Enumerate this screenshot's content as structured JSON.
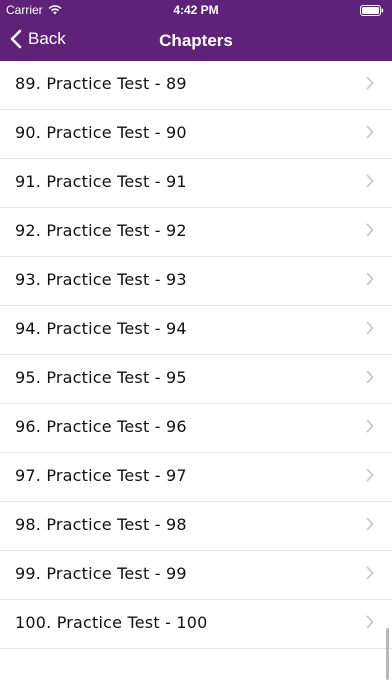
{
  "status_bar": {
    "carrier": "Carrier",
    "time": "4:42 PM",
    "wifi_icon": "wifi-icon",
    "battery_icon": "battery-icon"
  },
  "nav": {
    "back_label": "Back",
    "title": "Chapters",
    "back_icon": "chevron-left-icon"
  },
  "colors": {
    "nav_background": "#5e2378",
    "separator": "#e6e6e6",
    "chevron": "#c4c4c8"
  },
  "chapters": [
    "89. Practice Test - 89",
    "90. Practice Test - 90",
    "91. Practice Test - 91",
    "92. Practice Test - 92",
    "93. Practice Test - 93",
    "94. Practice Test - 94",
    "95. Practice Test - 95",
    "96. Practice Test - 96",
    "97. Practice Test - 97",
    "98. Practice Test - 98",
    "99. Practice Test - 99",
    "100. Practice Test - 100"
  ],
  "row_icon": "chevron-right-icon"
}
